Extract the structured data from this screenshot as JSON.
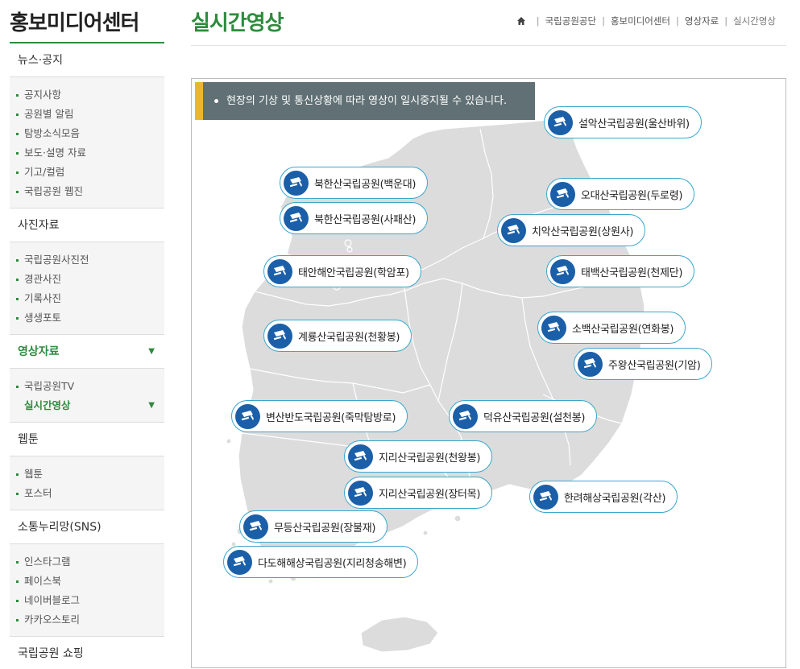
{
  "sidebar": {
    "title": "홍보미디어센터",
    "groups": [
      {
        "label": "뉴스·공지",
        "items": [
          "공지사항",
          "공원별 알림",
          "탐방소식모음",
          "보도·설명 자료",
          "기고/컬럼",
          "국립공원 웹진"
        ]
      },
      {
        "label": "사진자료",
        "items": [
          "국립공원사진전",
          "경관사진",
          "기록사진",
          "생생포토"
        ]
      },
      {
        "label": "영상자료",
        "items": [
          "국립공원TV",
          "실시간영상"
        ]
      },
      {
        "label": "웹툰",
        "items": [
          "웹툰",
          "포스터"
        ]
      },
      {
        "label": "소통누리망(SNS)",
        "items": [
          "인스타그램",
          "페이스북",
          "네이버블로그",
          "카카오스토리"
        ]
      },
      {
        "label": "국립공원 쇼핑"
      }
    ]
  },
  "page": {
    "title": "실시간영상"
  },
  "breadcrumb": [
    "국립공원공단",
    "홍보미디어센터",
    "영상자료",
    "실시간영상"
  ],
  "notice": "현장의 기상 및 통신상황에 따라 영상이 일시중지될 수 있습니다.",
  "colors": {
    "brand_green": "#2e8b3d",
    "notice_bg": "#607074",
    "notice_accent": "#e9b82a",
    "cam_border": "#3aa6cc",
    "cam_icon": "#1b5fa8",
    "map_fill": "#dcdcdc"
  },
  "cameras": [
    "설악산국립공원(울산바위)",
    "북한산국립공원(백운대)",
    "오대산국립공원(두로령)",
    "북한산국립공원(사패산)",
    "치악산국립공원(상원사)",
    "태안해안국립공원(학암포)",
    "태백산국립공원(천제단)",
    "소백산국립공원(연화봉)",
    "계룡산국립공원(천황봉)",
    "주왕산국립공원(기암)",
    "변산반도국립공원(죽막탐방로)",
    "덕유산국립공원(설천봉)",
    "지리산국립공원(천왕봉)",
    "지리산국립공원(장터목)",
    "한려해상국립공원(각산)",
    "무등산국립공원(장불재)",
    "다도해해상국립공원(지리청송해변)"
  ]
}
